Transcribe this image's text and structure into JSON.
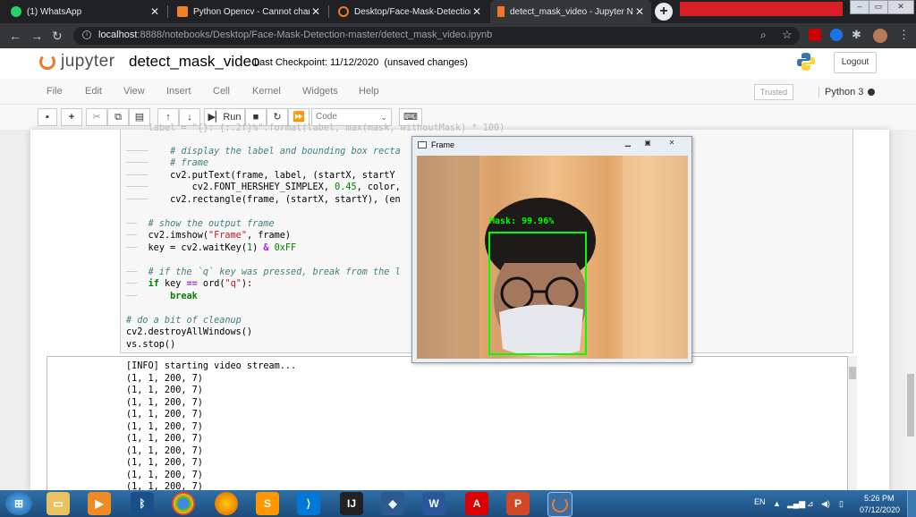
{
  "browser": {
    "tabs": [
      {
        "title": "(1) WhatsApp",
        "icon": "whatsapp-icon",
        "color": "#25d366",
        "active": false
      },
      {
        "title": "Python Opencv - Cannot change",
        "icon": "stackoverflow-icon",
        "color": "#f48024",
        "active": false
      },
      {
        "title": "Desktop/Face-Mask-Detection-m",
        "icon": "jupyter-icon",
        "color": "#f37726",
        "active": false
      },
      {
        "title": "detect_mask_video - Jupyter Not",
        "icon": "jupyter-hourglass-icon",
        "color": "#f37726",
        "active": true
      }
    ],
    "url_host": "localhost",
    "url_path": ":8888/notebooks/Desktop/Face-Mask-Detection-master/detect_mask_video.ipynb"
  },
  "jupyter": {
    "logo_text": "jupyter",
    "notebook_name": "detect_mask_video",
    "checkpoint": "Last Checkpoint: 11/12/2020",
    "save_status": "(unsaved changes)",
    "logout_label": "Logout",
    "menus": [
      "File",
      "Edit",
      "View",
      "Insert",
      "Cell",
      "Kernel",
      "Widgets",
      "Help"
    ],
    "trusted": "Trusted",
    "kernel": "Python 3",
    "run_label": "Run",
    "cell_type": "Code"
  },
  "frame_window": {
    "title": "Frame",
    "label": "Mask: 99.96%",
    "box_color": "#00ff00"
  },
  "output_lines": [
    "[INFO] starting video stream...",
    "(1, 1, 200, 7)",
    "(1, 1, 200, 7)",
    "(1, 1, 200, 7)",
    "(1, 1, 200, 7)",
    "(1, 1, 200, 7)",
    "(1, 1, 200, 7)",
    "(1, 1, 200, 7)",
    "(1, 1, 200, 7)",
    "(1, 1, 200, 7)",
    "(1, 1, 200, 7)"
  ],
  "taskbar": {
    "language": "EN",
    "time": "5:26 PM",
    "date": "07/12/2020"
  }
}
